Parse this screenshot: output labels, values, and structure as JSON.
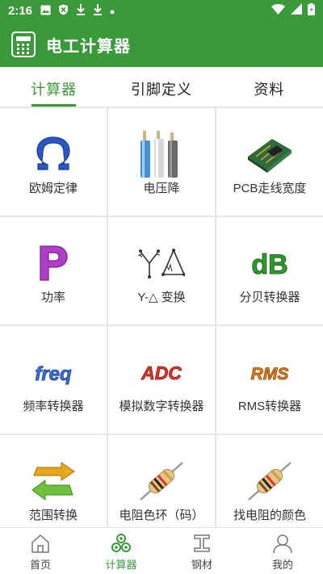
{
  "status": {
    "time": "2:16",
    "icons": [
      "image-icon",
      "shield-icon",
      "download-icon",
      "download-icon",
      "dot-icon"
    ],
    "right_icons": [
      "wifi-icon",
      "signal-icon",
      "battery-icon"
    ]
  },
  "appbar": {
    "title": "电工计算器",
    "icon": "calculator-icon"
  },
  "tabs": [
    {
      "label": "计算器",
      "active": true
    },
    {
      "label": "引脚定义",
      "active": false
    },
    {
      "label": "资料",
      "active": false
    }
  ],
  "tools": [
    {
      "label": "欧姆定律",
      "icon": "omega-icon"
    },
    {
      "label": "电压降",
      "icon": "cables-icon"
    },
    {
      "label": "PCB走线宽度",
      "icon": "pcb-icon"
    },
    {
      "label": "功率",
      "icon": "letter-p-icon",
      "icon_text": "P"
    },
    {
      "label": "Y-△ 变换",
      "icon": "wye-delta-icon"
    },
    {
      "label": "分贝转换器",
      "icon": "db-icon",
      "icon_text": "dB"
    },
    {
      "label": "频率转换器",
      "icon": "freq-icon",
      "icon_text": "freq"
    },
    {
      "label": "模拟数字转换器",
      "icon": "adc-icon",
      "icon_text": "ADC"
    },
    {
      "label": "RMS转换器",
      "icon": "rms-icon",
      "icon_text": "RMS"
    },
    {
      "label": "范围转换",
      "icon": "swap-arrows-icon"
    },
    {
      "label": "电阻色环（码）",
      "icon": "resistor-icon"
    },
    {
      "label": "找电阻的颜色",
      "icon": "resistor-icon"
    }
  ],
  "bottom_nav": [
    {
      "label": "首页",
      "icon": "home-icon",
      "active": false
    },
    {
      "label": "计算器",
      "icon": "hex-cluster-icon",
      "active": true
    },
    {
      "label": "钢材",
      "icon": "i-beam-icon",
      "active": false
    },
    {
      "label": "我的",
      "icon": "person-icon",
      "active": false
    }
  ],
  "colors": {
    "primary": "#3a9a3a",
    "omega_blue": "#2a56c6",
    "p_purple": "#b03ec9",
    "db_green": "#2e9a2e",
    "freq_blue": "#3a6fd8",
    "adc_red": "#d9362c",
    "rms_orange": "#e07a1a"
  }
}
